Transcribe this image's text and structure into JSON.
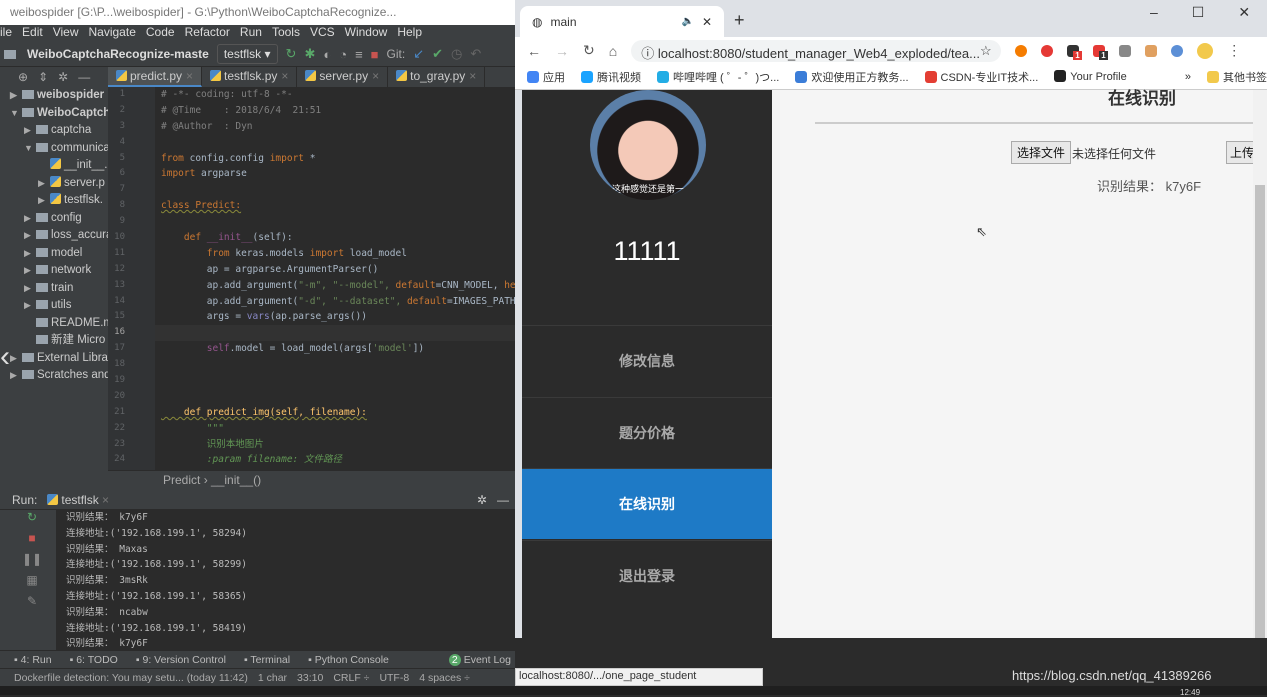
{
  "ide": {
    "title": "weibospider [G:\\P...\\weibospider] - G:\\Python\\WeiboCaptchaRecognize...",
    "menu": [
      "ile",
      "Edit",
      "View",
      "Navigate",
      "Code",
      "Refactor",
      "Run",
      "Tools",
      "VCS",
      "Window",
      "Help"
    ],
    "project_name": "WeiboCaptchaRecognize-maste",
    "run_config": "testflsk",
    "git_label": "Git:",
    "tabs": [
      {
        "label": "predict.py",
        "active": true
      },
      {
        "label": "testflsk.py"
      },
      {
        "label": "server.py"
      },
      {
        "label": "to_gray.py"
      }
    ],
    "tree": [
      {
        "label": "weibospider",
        "indent": 0,
        "arrow": "▶",
        "type": "folder",
        "bold": true
      },
      {
        "label": "WeiboCaptch",
        "indent": 0,
        "arrow": "▼",
        "type": "folder",
        "bold": true
      },
      {
        "label": "captcha",
        "indent": 1,
        "arrow": "▶",
        "type": "folder"
      },
      {
        "label": "communica",
        "indent": 1,
        "arrow": "▼",
        "type": "folder"
      },
      {
        "label": "__init__.",
        "indent": 2,
        "arrow": "",
        "type": "py"
      },
      {
        "label": "server.p",
        "indent": 2,
        "arrow": "▶",
        "type": "py"
      },
      {
        "label": "testflsk.",
        "indent": 2,
        "arrow": "▶",
        "type": "py"
      },
      {
        "label": "config",
        "indent": 1,
        "arrow": "▶",
        "type": "folder"
      },
      {
        "label": "loss_accura",
        "indent": 1,
        "arrow": "▶",
        "type": "folder"
      },
      {
        "label": "model",
        "indent": 1,
        "arrow": "▶",
        "type": "folder"
      },
      {
        "label": "network",
        "indent": 1,
        "arrow": "▶",
        "type": "folder"
      },
      {
        "label": "train",
        "indent": 1,
        "arrow": "▶",
        "type": "folder"
      },
      {
        "label": "utils",
        "indent": 1,
        "arrow": "▶",
        "type": "folder"
      },
      {
        "label": "README.m",
        "indent": 1,
        "arrow": "",
        "type": "file"
      },
      {
        "label": "新建 Micro",
        "indent": 1,
        "arrow": "",
        "type": "file"
      },
      {
        "label": "External Librar",
        "indent": 0,
        "arrow": "▶",
        "type": "lib"
      },
      {
        "label": "Scratches and",
        "indent": 0,
        "arrow": "▶",
        "type": "scratch"
      }
    ],
    "code": [
      [
        [
          "# -*- coding: utf-8 -*-",
          "cm"
        ]
      ],
      [
        [
          "# @Time    : 2018/6/4  21:51",
          "cm"
        ]
      ],
      [
        [
          "# @Author  : Dyn",
          "cm"
        ]
      ],
      [],
      [
        [
          "from",
          "kw"
        ],
        [
          " config.config ",
          "tx"
        ],
        [
          "import",
          "kw"
        ],
        [
          " *",
          "tx"
        ]
      ],
      [
        [
          "import",
          "kw"
        ],
        [
          " argparse",
          "tx"
        ]
      ],
      [],
      [
        [
          "class Predict:",
          "kw ul"
        ]
      ],
      [],
      [
        [
          "    def ",
          "kw"
        ],
        [
          "__init__",
          "sf"
        ],
        [
          "(self):",
          "tx"
        ]
      ],
      [
        [
          "        from",
          "kw"
        ],
        [
          " keras.models ",
          "tx"
        ],
        [
          "import",
          "kw"
        ],
        [
          " load_model",
          "tx"
        ]
      ],
      [
        [
          "        ap = argparse.ArgumentParser()",
          "tx"
        ]
      ],
      [
        [
          "        ap.add_argument(",
          "tx"
        ],
        [
          "\"-m\", \"--model\", ",
          "st"
        ],
        [
          "default",
          "kw"
        ],
        [
          "=CNN_MODEL, ",
          "tx"
        ],
        [
          "help",
          "kw"
        ],
        [
          "=\"r",
          "st"
        ]
      ],
      [
        [
          "        ap.add_argument(",
          "tx"
        ],
        [
          "\"-d\", \"--dataset\", ",
          "st"
        ],
        [
          "default",
          "kw"
        ],
        [
          "=IMAGES_PATH, ",
          "tx"
        ],
        [
          "he",
          "kw"
        ]
      ],
      [
        [
          "        args = ",
          "tx"
        ],
        [
          "vars",
          "bi"
        ],
        [
          "(ap.parse_args())",
          "tx"
        ]
      ],
      [],
      [
        [
          "        self",
          "sf"
        ],
        [
          ".model = load_model(args[",
          "tx"
        ],
        [
          "'model'",
          "st"
        ],
        [
          "])",
          "tx"
        ]
      ],
      [],
      [],
      [],
      [
        [
          "    def predict_img(self, filename):",
          "fn ul"
        ]
      ],
      [
        [
          "        \"\"\"",
          "doc"
        ]
      ],
      [
        [
          "        识别本地图片",
          "dcn"
        ]
      ],
      [
        [
          "        :param filename: 文件路径",
          "doc"
        ]
      ]
    ],
    "current_line": 16,
    "breadcrumb": [
      "Predict",
      "__init__()"
    ],
    "run": {
      "label": "Run:",
      "tab": "testflsk",
      "output": [
        "识别结果： k7y6F",
        "连接地址:('192.168.199.1', 58294)",
        "识别结果： Maxas",
        "连接地址:('192.168.199.1', 58299)",
        "识别结果： 3msRk",
        "连接地址:('192.168.199.1', 58365)",
        "识别结果： ncabw",
        "连接地址:('192.168.199.1', 58419)",
        "识别结果： k7y6F"
      ]
    },
    "tool_windows": [
      "4: Run",
      "6: TODO",
      "9: Version Control",
      "Terminal",
      "Python Console",
      "Event Log"
    ],
    "event_log_count": "2",
    "status": {
      "message": "Dockerfile detection: You may setu... (today 11:42)",
      "selection": "1 char",
      "position": "33:10",
      "line_sep": "CRLF ÷",
      "encoding": "UTF-8",
      "indent": "4 spaces ÷"
    }
  },
  "browser": {
    "tab_title": "main",
    "url": "localhost:8080/student_manager_Web4_exploded/tea...",
    "bookmarks": [
      "应用",
      "腾讯视频",
      "哔哩哔哩 ( ゜- ゜)つ...",
      "欢迎使用正方教务...",
      "CSDN-专业IT技术...",
      "Your Profile",
      "»",
      "其他书签"
    ],
    "extension_badges": [
      "1",
      "1"
    ],
    "status_url": "localhost:8080/.../one_page_student"
  },
  "page": {
    "username": "11111",
    "avatar_caption": "这种感觉还是第一",
    "nav": [
      {
        "label": "修改信息"
      },
      {
        "label": "题分价格"
      },
      {
        "label": "在线识别",
        "active": true
      },
      {
        "label": "退出登录"
      }
    ],
    "title": "在线识别",
    "choose_file": "选择文件",
    "no_file": "未选择任何文件",
    "upload": "上传",
    "result": "识别结果：  k7y6F",
    "accent": "#1e7ac6"
  },
  "watermark": "https://blog.csdn.net/qq_41389266",
  "clock": "12:49"
}
